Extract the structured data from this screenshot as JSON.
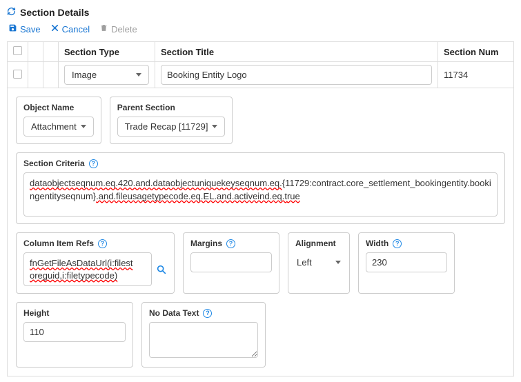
{
  "header": {
    "title": "Section Details"
  },
  "toolbar": {
    "save": "Save",
    "cancel": "Cancel",
    "delete": "Delete"
  },
  "table": {
    "headers": {
      "section_type": "Section Type",
      "section_title": "Section Title",
      "section_num": "Section Num"
    },
    "row": {
      "section_type": "Image",
      "section_title": "Booking Entity Logo",
      "section_num": "11734"
    }
  },
  "details": {
    "object_name": {
      "label": "Object Name",
      "value": "Attachment"
    },
    "parent_section": {
      "label": "Parent Section",
      "value": "Trade Recap [11729]"
    },
    "section_criteria": {
      "label": "Section Criteria",
      "seg_a": "dataobjectseqnum.eq.420.and.dataobjectuniquekeyseqnum.eq.",
      "seg_b": "{11729:contract.core_settlement_bookingentity.bookingentityseqnum}",
      "seg_c": ".and.fileusagetypecode.eq.EL.and.activeind.eq.t",
      "seg_d": "rue"
    },
    "column_item_refs": {
      "label": "Column Item Refs",
      "line1": "fnGetFileAsDataUrl(i:filest",
      "line2": "oreguid,i:filetypecode)"
    },
    "margins": {
      "label": "Margins",
      "value": ""
    },
    "alignment": {
      "label": "Alignment",
      "value": "Left"
    },
    "width": {
      "label": "Width",
      "value": "230"
    },
    "height": {
      "label": "Height",
      "value": "110"
    },
    "no_data_text": {
      "label": "No Data Text",
      "value": ""
    }
  }
}
